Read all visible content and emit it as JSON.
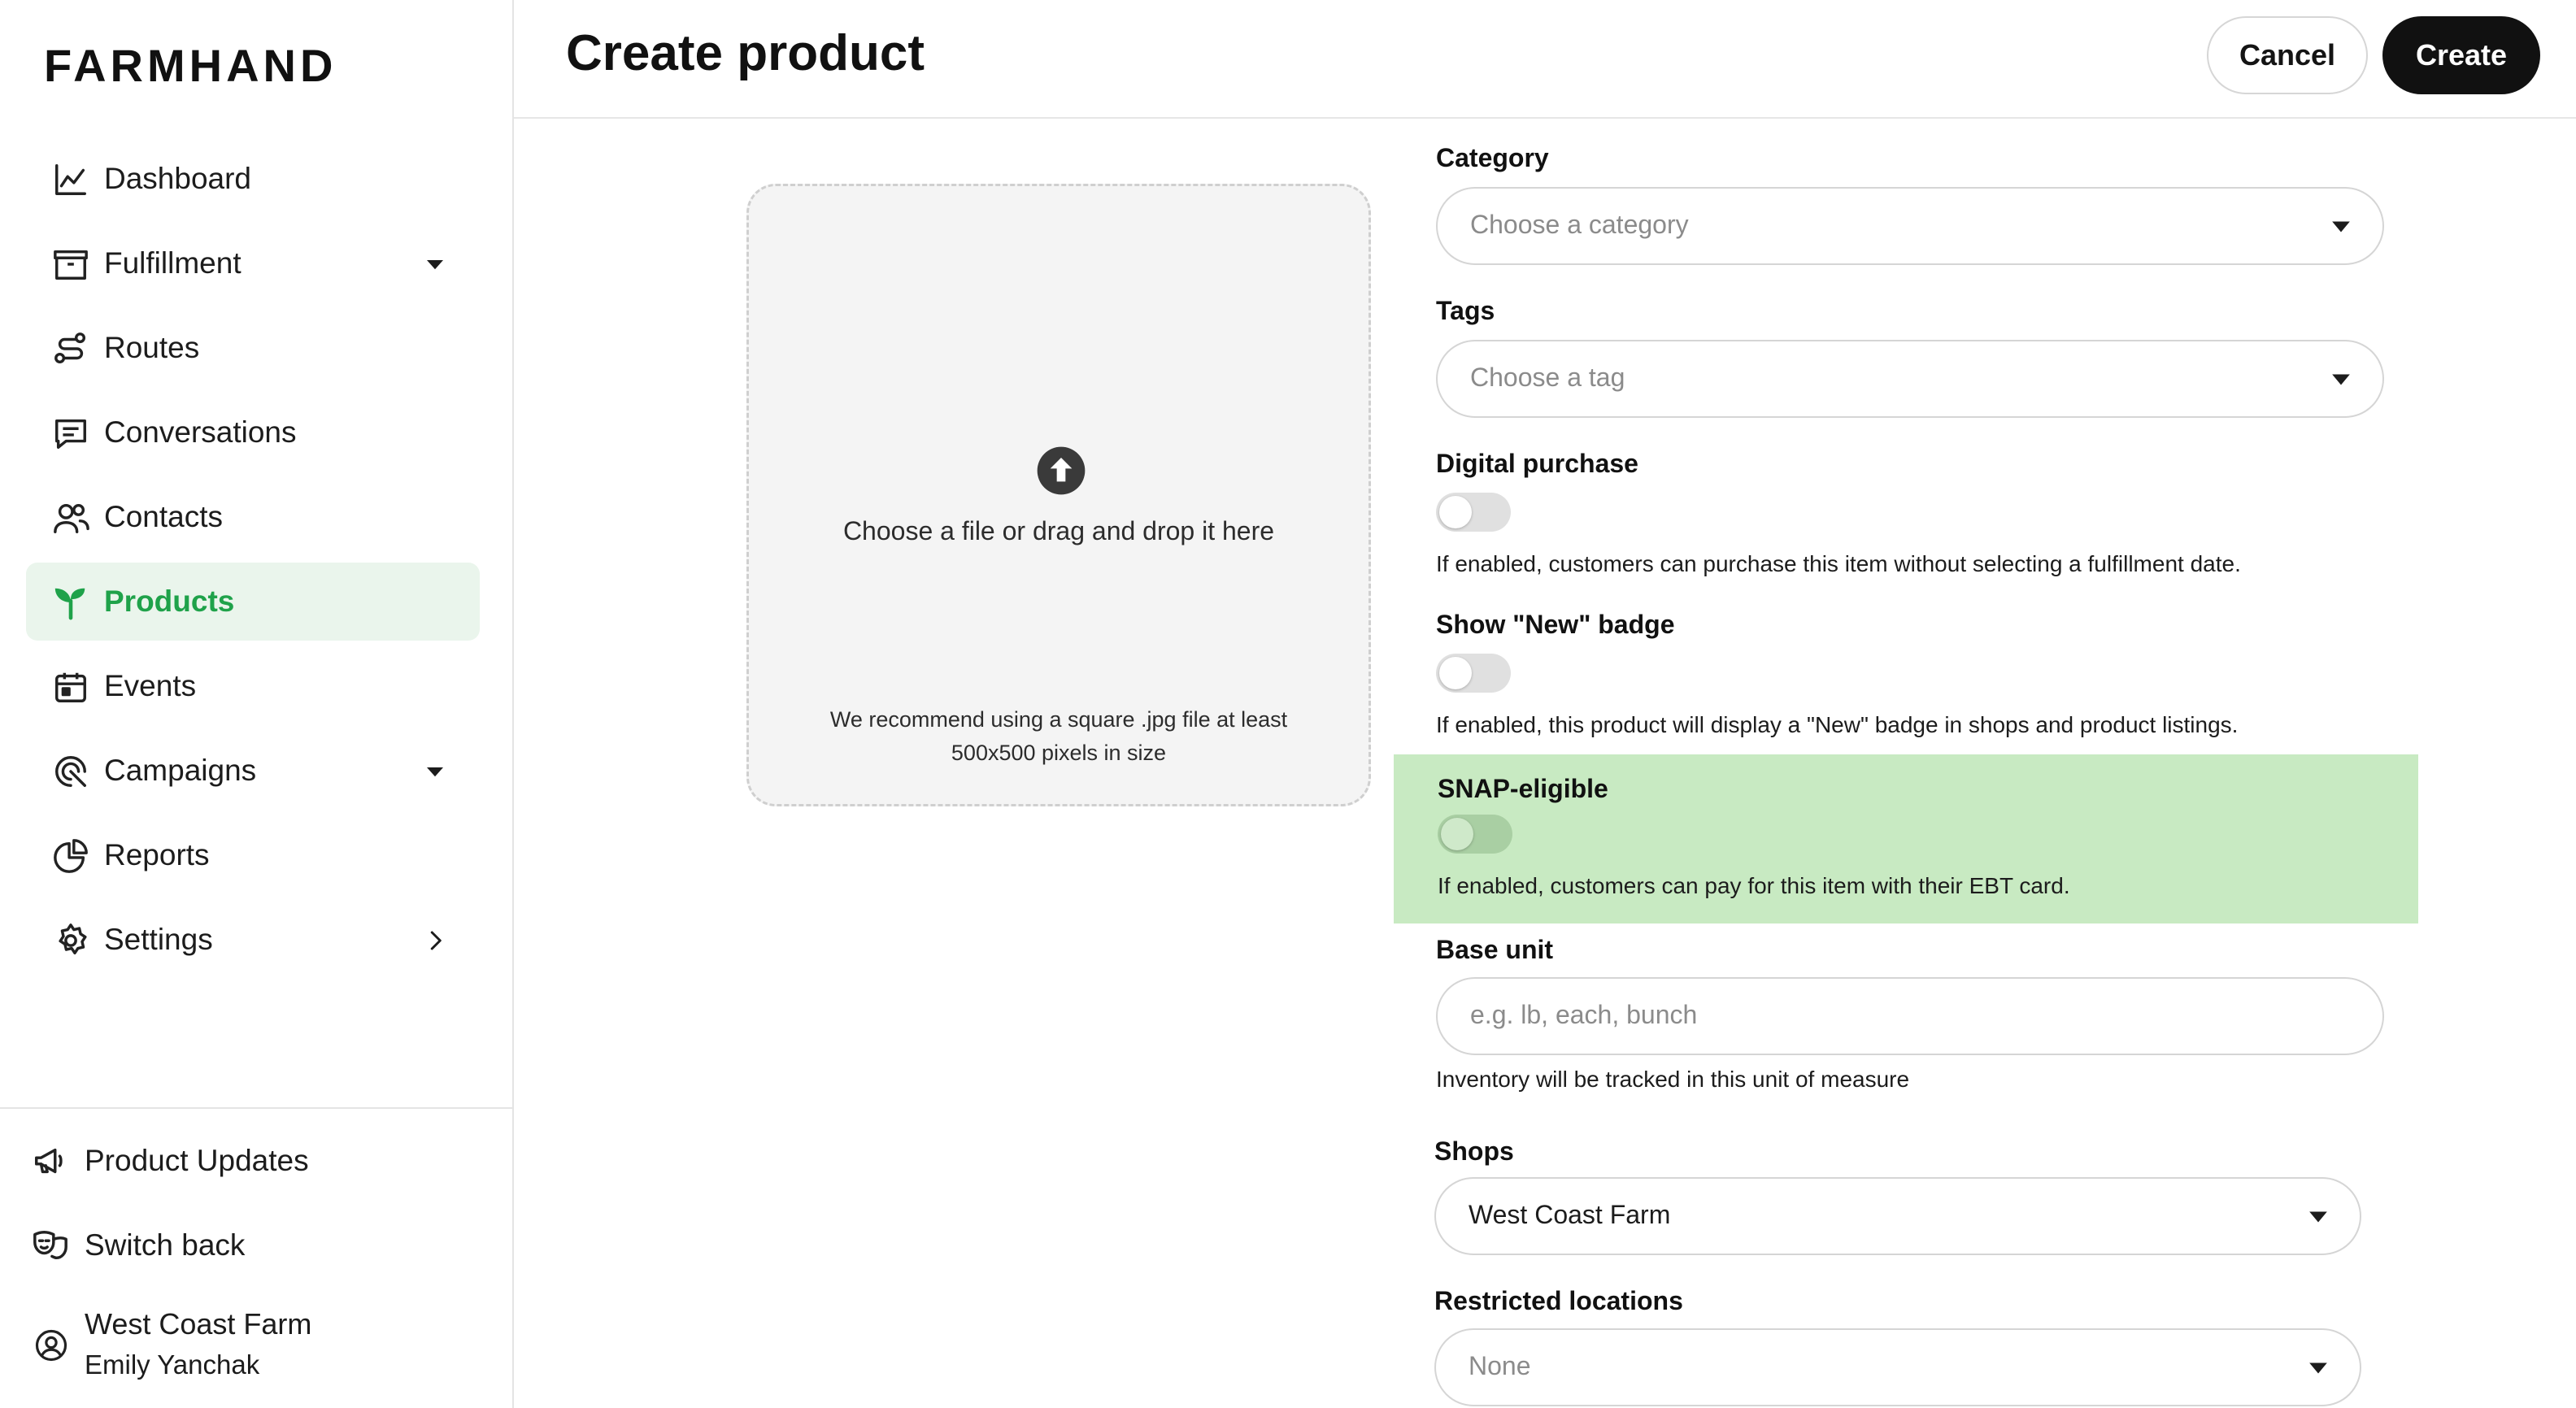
{
  "app": {
    "brand": "FARMHAND"
  },
  "colors": {
    "accent": "#1fa24a",
    "active_bg": "#eaf5ec",
    "highlight": "#c8eac2"
  },
  "sidebar": {
    "items": [
      {
        "label": "Dashboard",
        "icon": "chart-line-icon"
      },
      {
        "label": "Fulfillment",
        "icon": "box-icon",
        "chevron": "caret-down"
      },
      {
        "label": "Routes",
        "icon": "route-icon"
      },
      {
        "label": "Conversations",
        "icon": "chat-icon"
      },
      {
        "label": "Contacts",
        "icon": "contacts-icon"
      },
      {
        "label": "Products",
        "icon": "sprout-icon",
        "active": true
      },
      {
        "label": "Events",
        "icon": "calendar-icon"
      },
      {
        "label": "Campaigns",
        "icon": "campaign-icon",
        "chevron": "caret-down"
      },
      {
        "label": "Reports",
        "icon": "pie-chart-icon"
      },
      {
        "label": "Settings",
        "icon": "gear-icon",
        "chevron": "chevron-right"
      }
    ],
    "bottom": {
      "product_updates": "Product Updates",
      "switch_back": "Switch back",
      "farm_name": "West Coast Farm",
      "user_name": "Emily Yanchak"
    }
  },
  "header": {
    "title": "Create product",
    "cancel_label": "Cancel",
    "create_label": "Create"
  },
  "upload": {
    "text": "Choose a file or drag and drop it here",
    "hint_line1": "We recommend using a square .jpg file at least",
    "hint_line2": "500x500 pixels in size"
  },
  "form": {
    "category": {
      "label": "Category",
      "placeholder": "Choose a category"
    },
    "tags": {
      "label": "Tags",
      "placeholder": "Choose a tag"
    },
    "digital_purchase": {
      "label": "Digital purchase",
      "help": "If enabled, customers can purchase this item without selecting a fulfillment date.",
      "enabled": false
    },
    "new_badge": {
      "label": "Show \"New\" badge",
      "help": "If enabled, this product will display a \"New\" badge in shops and product listings.",
      "enabled": false
    },
    "snap": {
      "label": "SNAP-eligible",
      "help": "If enabled, customers can pay for this item with their EBT card.",
      "enabled": false
    },
    "base_unit": {
      "label": "Base unit",
      "placeholder": "e.g. lb, each, bunch",
      "help": "Inventory will be tracked in this unit of measure"
    },
    "shops": {
      "label": "Shops",
      "value": "West Coast Farm"
    },
    "restricted": {
      "label": "Restricted locations",
      "value": "None"
    }
  }
}
